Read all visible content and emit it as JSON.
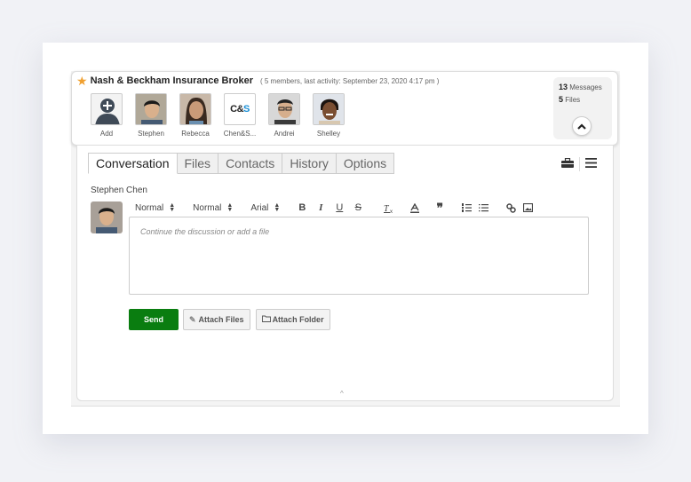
{
  "group": {
    "title": "Nash & Beckham Insurance Broker",
    "meta": "( 5 members, last activity: September 23, 2020 4:17 pm )",
    "members": [
      {
        "name": "Add",
        "type": "add"
      },
      {
        "name": "Stephen",
        "type": "photo"
      },
      {
        "name": "Rebecca",
        "type": "photo"
      },
      {
        "name": "Chen&S...",
        "type": "logo",
        "logo_text": "C&S"
      },
      {
        "name": "Andrei",
        "type": "photo"
      },
      {
        "name": "Shelley",
        "type": "photo"
      }
    ],
    "stats": {
      "messages_count": "13",
      "messages_label": "Messages",
      "files_count": "5",
      "files_label": "Files"
    }
  },
  "tabs": [
    {
      "label": "Conversation",
      "active": true
    },
    {
      "label": "Files",
      "active": false
    },
    {
      "label": "Contacts",
      "active": false
    },
    {
      "label": "History",
      "active": false
    },
    {
      "label": "Options",
      "active": false
    }
  ],
  "composer": {
    "author": "Stephen Chen",
    "toolbar": {
      "heading_select": "Normal",
      "size_select": "Normal",
      "font_select": "Arial",
      "bold": "B",
      "italic": "I",
      "underline": "U",
      "strike": "S"
    },
    "placeholder": "Continue the discussion or add a file",
    "send_label": "Send",
    "attach_files_label": "Attach Files",
    "attach_folder_label": "Attach Folder"
  },
  "colors": {
    "send": "#0a7d10",
    "star": "#f0a030",
    "logo_blue": "#1a8fd6"
  }
}
